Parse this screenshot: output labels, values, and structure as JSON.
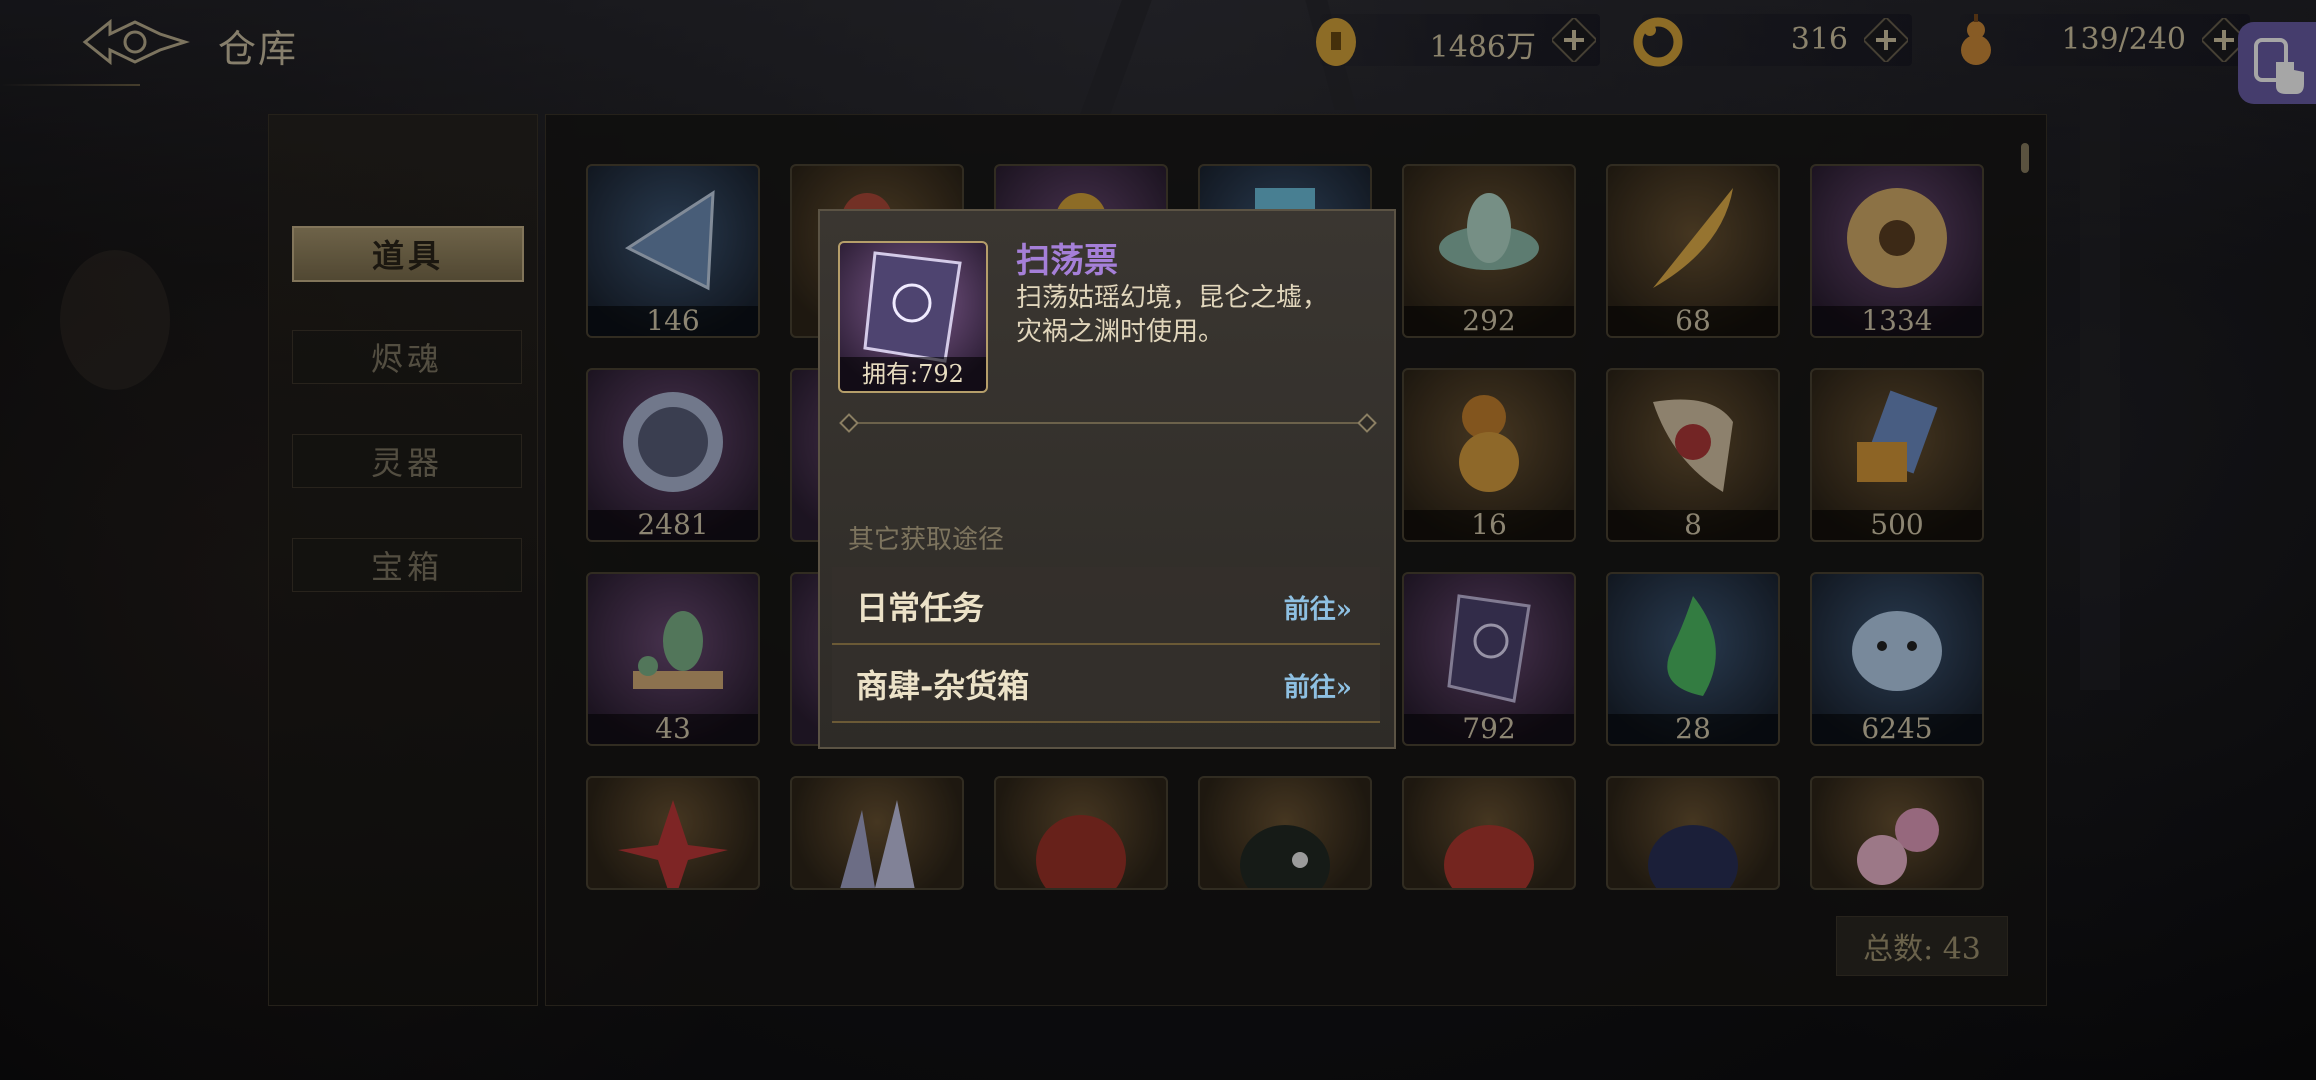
{
  "header": {
    "title": "仓库",
    "resources": [
      {
        "icon": "coin-icon",
        "value": "1486万"
      },
      {
        "icon": "jade-ring-icon",
        "value": "316"
      },
      {
        "icon": "gourd-stamina-icon",
        "value": "139/240"
      }
    ]
  },
  "sidebar": {
    "tabs": [
      {
        "label": "道具",
        "active": true
      },
      {
        "label": "烬魂",
        "active": false
      },
      {
        "label": "灵器",
        "active": false
      },
      {
        "label": "宝箱",
        "active": false
      }
    ]
  },
  "grid": {
    "rows": [
      [
        "146",
        "",
        "",
        "",
        "292",
        "68",
        "1334"
      ],
      [
        "2481",
        "",
        "",
        "",
        "16",
        "8",
        "500"
      ],
      [
        "43",
        "",
        "",
        "",
        "792",
        "28",
        "6245"
      ],
      [
        "",
        "",
        "",
        "",
        "",
        "",
        ""
      ]
    ],
    "icons": [
      [
        "crystal-pyramid-icon",
        "scroll-icon",
        "orb-icon",
        "gem-icon",
        "lotus-icon",
        "feather-icon",
        "golden-disc-icon"
      ],
      [
        "beast-medallion-icon",
        "item-icon",
        "item-icon",
        "item-icon",
        "gourd-icon",
        "talisman-icon",
        "book-icon"
      ],
      [
        "wine-jar-icon",
        "item-icon",
        "item-icon",
        "item-icon",
        "sweep-ticket-icon",
        "green-flame-icon",
        "ghost-plush-icon"
      ],
      [
        "red-flower-icon",
        "crystal-cluster-icon",
        "red-gourd-icon",
        "dark-ghost-icon",
        "red-ghost-icon",
        "blue-ghost-icon",
        "pink-flower-icon"
      ]
    ],
    "total": "总数: 43"
  },
  "popup": {
    "name": "扫荡票",
    "description_line1": "扫荡姑瑶幻境，昆仑之墟，",
    "description_line2": "灾祸之渊时使用。",
    "owned": "拥有:792",
    "sources_heading": "其它获取途径",
    "routes": [
      {
        "label": "日常任务",
        "go": "前往»"
      },
      {
        "label": "商肆-杂货箱",
        "go": "前往»"
      }
    ]
  },
  "colors": {
    "accent_gold": "#c8b48a",
    "name_purple": "#a57fd8",
    "link_blue": "#8ec0e2"
  }
}
